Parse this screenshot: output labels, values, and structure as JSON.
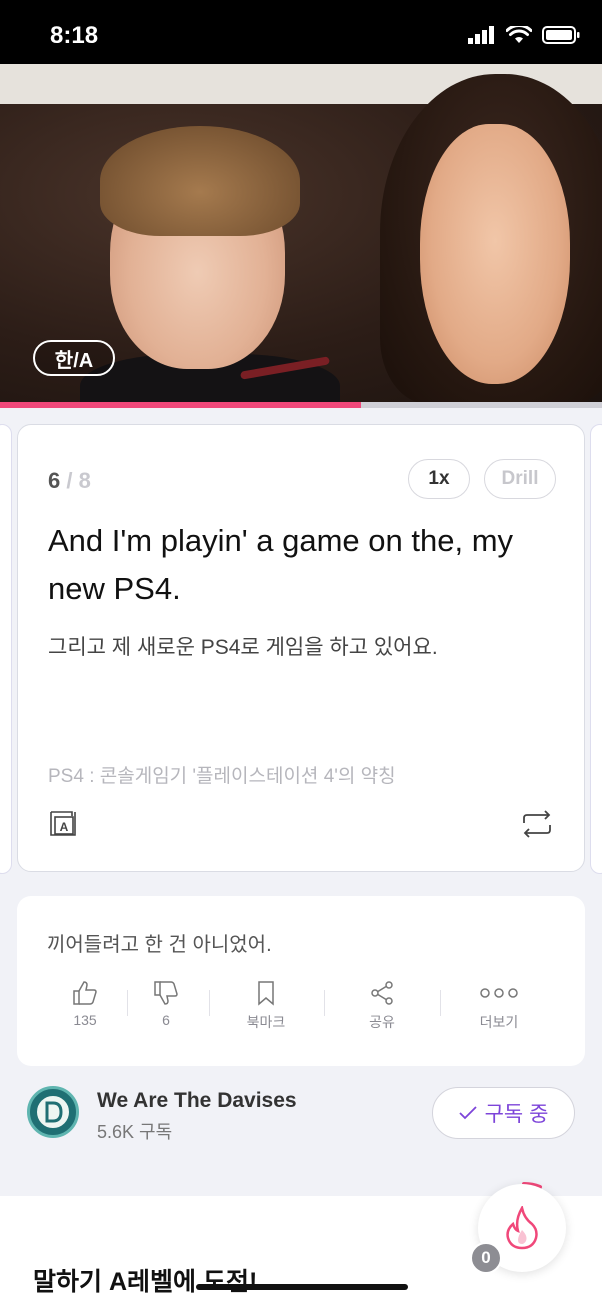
{
  "status_bar": {
    "time": "8:18"
  },
  "video": {
    "lang_toggle_label": "한/A",
    "progress_fraction": 0.6
  },
  "subtitle_card": {
    "current_index": "6",
    "separator": "/",
    "total": "8",
    "speed_label": "1x",
    "drill_label": "Drill",
    "english": "And I'm playin' a game on the, my new PS4.",
    "korean": "그리고 제 새로운 PS4로 게임을 하고 있어요.",
    "note": "PS4 : 콘솔게임기 '플레이스테이션 4'의 약칭",
    "dict_icon_letter": "A"
  },
  "comment": {
    "text": "끼어들려고 한 건 아니었어.",
    "actions": [
      {
        "icon": "thumbs-up-icon",
        "label": "135"
      },
      {
        "icon": "thumbs-down-icon",
        "label": "6"
      },
      {
        "icon": "bookmark-icon",
        "label": "북마크"
      },
      {
        "icon": "share-icon",
        "label": "공유"
      },
      {
        "icon": "more-icon",
        "label": "더보기"
      }
    ]
  },
  "channel": {
    "name": "We Are The Davises",
    "subscribers": "5.6K 구독",
    "subscribe_label": "구독 중"
  },
  "bottom": {
    "challenge_title": "말하기 A레벨에 도전!",
    "streak_count": "0"
  },
  "colors": {
    "accent_pink": "#f0487a",
    "subscribe_purple": "#7d44d9",
    "background": "#f1f2f7"
  }
}
